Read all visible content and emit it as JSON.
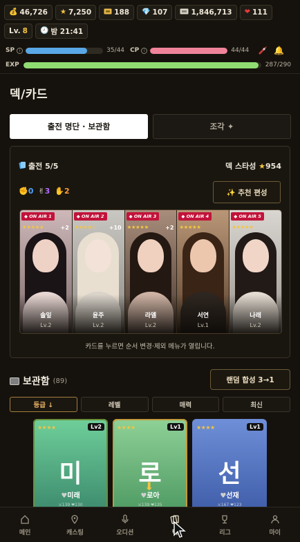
{
  "resources": {
    "gold": "46,726",
    "stars": "7,250",
    "tickets": "188",
    "gems": "107",
    "cash": "1,846,713",
    "hearts": "111"
  },
  "player": {
    "level_label": "Lv.",
    "level": "8",
    "time": "밤 21:41"
  },
  "stats": {
    "sp_label": "SP",
    "sp_text": "35/44",
    "sp_fraction": 0.795,
    "cp_label": "CP",
    "cp_text": "44/44",
    "cp_fraction": 1.0,
    "exp_label": "EXP",
    "exp_text": "287/290",
    "exp_fraction": 0.99
  },
  "page_title": "덱/카드",
  "tabs": [
    {
      "label": "출전 명단 · 보관함",
      "active": true
    },
    {
      "label": "조각 ✦",
      "active": false
    }
  ],
  "lineup": {
    "title": "출전 5/5",
    "deck_star_label": "덱 스타성",
    "deck_star_value": "954",
    "emotes": [
      {
        "icon": "✊",
        "value": "0",
        "color": "#4da3ff"
      },
      {
        "icon": "✌",
        "value": "3",
        "color": "#b36bff"
      },
      {
        "icon": "✋",
        "value": "2",
        "color": "#ff9b3d"
      }
    ],
    "recommend_label": "✨ 추천 편성",
    "cards": [
      {
        "tag": "◆ ON AIR 1",
        "stars": "★★★★★",
        "plus": "+2",
        "name": "솔잎",
        "lv": "Lv.2"
      },
      {
        "tag": "◆ ON AIR 2",
        "stars": "★★★★☆",
        "plus": "+10",
        "name": "윤주",
        "lv": "Lv.2"
      },
      {
        "tag": "◆ ON AIR 3",
        "stars": "★★★★★",
        "plus": "+2",
        "name": "라엘",
        "lv": "Lv.2"
      },
      {
        "tag": "◆ ON AIR 4",
        "stars": "★★★★★",
        "plus": "",
        "name": "서연",
        "lv": "Lv.1"
      },
      {
        "tag": "◆ ON AIR 5",
        "stars": "★★★★★",
        "plus": "",
        "name": "나래",
        "lv": "Lv.2"
      }
    ],
    "hint": "카드를 누르면 순서 변경·제외 메뉴가 열립니다."
  },
  "storage": {
    "title": "보관함",
    "count": "(89)",
    "merge_label": "랜덤 합성 3→1",
    "sorts": [
      {
        "label": "등급 ↓",
        "active": true
      },
      {
        "label": "레벨",
        "active": false
      },
      {
        "label": "매력",
        "active": false
      },
      {
        "label": "최신",
        "active": false
      }
    ],
    "cards": [
      {
        "stars": "★★★★",
        "lv": "Lv2",
        "big": "미",
        "name": "미래",
        "stats": "⚔139 ❤130"
      },
      {
        "stars": "★★★★",
        "lv": "Lv1",
        "big": "로",
        "name": "로아",
        "stats": "⚔139 ❤135"
      },
      {
        "stars": "★★★★",
        "lv": "Lv1",
        "big": "선",
        "name": "선재",
        "stats": "⚔167 ❤123"
      }
    ]
  },
  "nav": [
    {
      "label": "메인",
      "icon": "home-icon"
    },
    {
      "label": "캐스팅",
      "icon": "location-pin-icon"
    },
    {
      "label": "오디션",
      "icon": "microphone-icon"
    },
    {
      "label": "덱",
      "icon": "cards-icon",
      "active": true
    },
    {
      "label": "리그",
      "icon": "trophy-icon"
    },
    {
      "label": "마이",
      "icon": "person-icon"
    }
  ],
  "colors": {
    "sp": "#5aa7e6",
    "cp": "#f0839a",
    "exp": "#8fdd72",
    "accent_gold": "#ecb465",
    "on_air_tag": "#c2133a"
  }
}
